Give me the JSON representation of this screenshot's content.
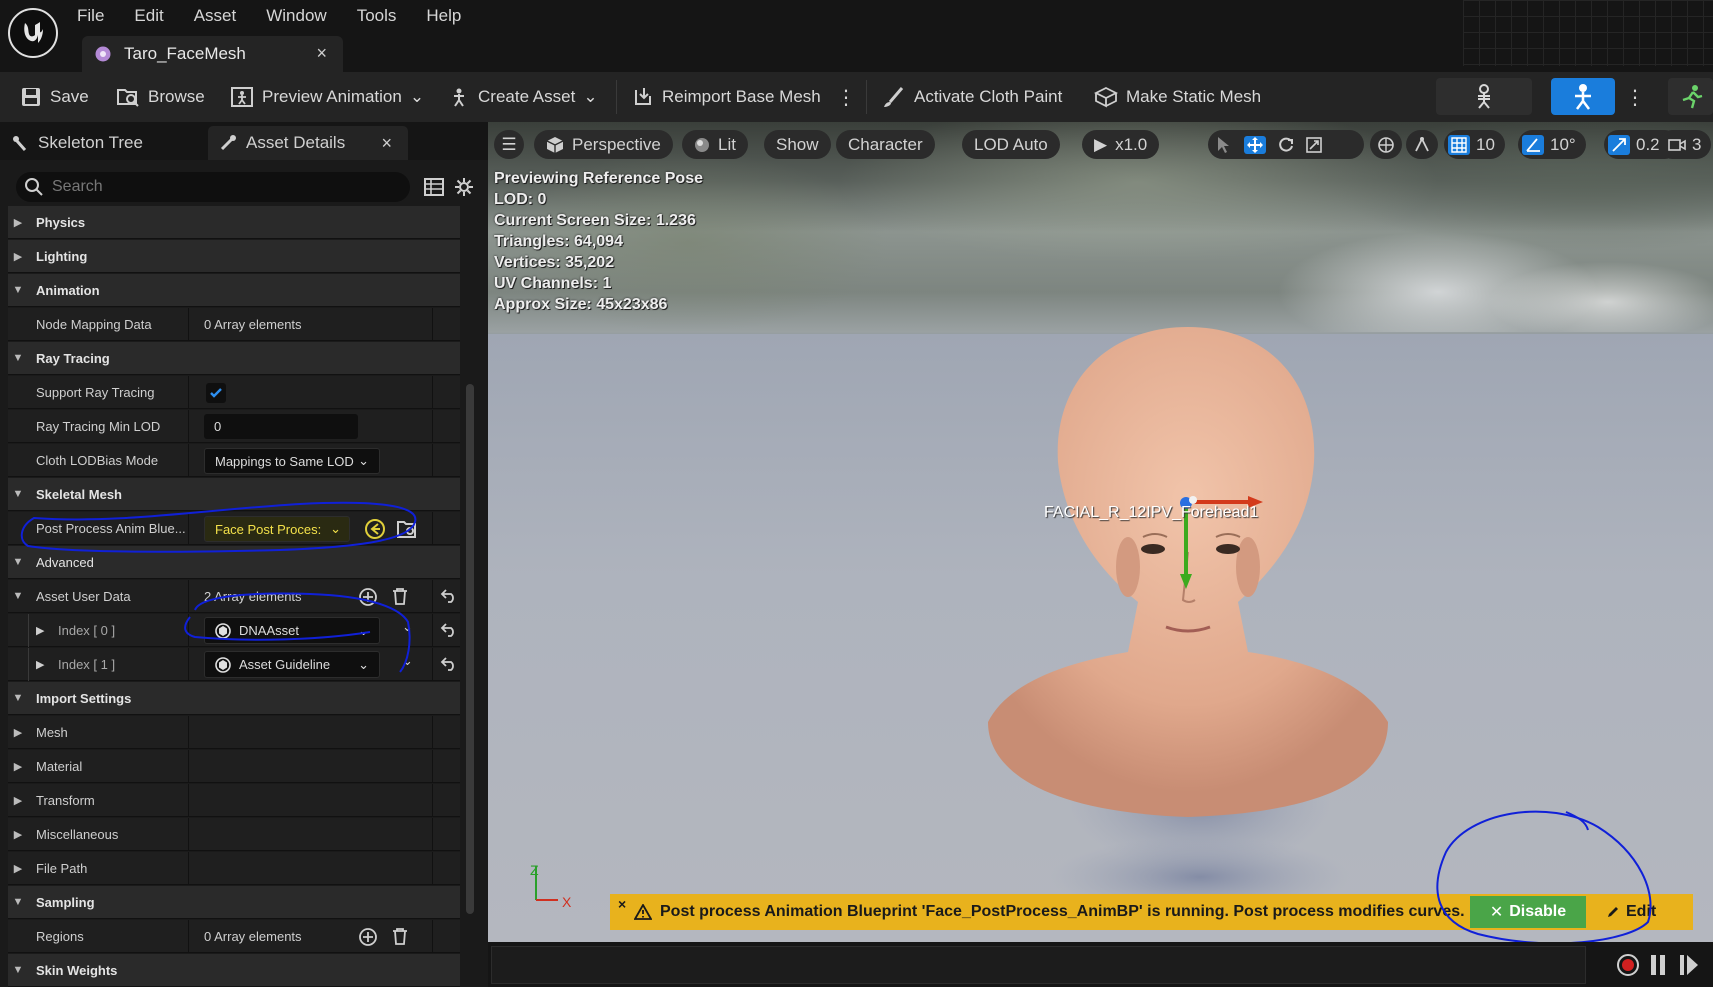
{
  "menu": [
    "File",
    "Edit",
    "Asset",
    "Window",
    "Tools",
    "Help"
  ],
  "doc_tab": {
    "title": "Taro_FaceMesh",
    "close": "×"
  },
  "toolbar": {
    "save": "Save",
    "browse": "Browse",
    "preview_animation": "Preview Animation",
    "create_asset": "Create Asset",
    "reimport": "Reimport Base Mesh",
    "cloth_paint": "Activate Cloth Paint",
    "static_mesh": "Make Static Mesh"
  },
  "panel_tabs": {
    "skeleton_tree": "Skeleton Tree",
    "asset_details": "Asset Details",
    "close": "×"
  },
  "search": {
    "placeholder": "Search"
  },
  "details": {
    "physics": "Physics",
    "lighting": "Lighting",
    "animation": "Animation",
    "node_mapping": {
      "label": "Node Mapping Data",
      "value": "0 Array elements"
    },
    "ray_tracing": "Ray Tracing",
    "support_ray_tracing": "Support Ray Tracing",
    "rt_min_lod": {
      "label": "Ray Tracing Min LOD",
      "value": "0"
    },
    "cloth_lod": {
      "label": "Cloth LODBias Mode",
      "value": "Mappings to Same LOD"
    },
    "skeletal_mesh": "Skeletal Mesh",
    "post_process": {
      "label": "Post Process Anim Blue...",
      "value": "Face Post Proces:"
    },
    "advanced": "Advanced",
    "asset_user_data": {
      "label": "Asset User Data",
      "value": "2 Array elements"
    },
    "index0": {
      "label": "Index [ 0 ]",
      "value": "DNAAsset"
    },
    "index1": {
      "label": "Index [ 1 ]",
      "value": "Asset Guideline"
    },
    "import_settings": "Import Settings",
    "mesh": "Mesh",
    "material": "Material",
    "transform": "Transform",
    "misc": "Miscellaneous",
    "file_path": "File Path",
    "sampling": "Sampling",
    "regions": {
      "label": "Regions",
      "value": "0 Array elements"
    },
    "skin_weights": "Skin Weights"
  },
  "viewport": {
    "perspective": "Perspective",
    "lit": "Lit",
    "show": "Show",
    "character": "Character",
    "lod": "LOD Auto",
    "speed": "x1.0",
    "grid": "10",
    "angle": "10°",
    "scale": "0.25",
    "camera": "3",
    "stats": [
      "Previewing Reference Pose",
      "LOD: 0",
      "Current Screen Size: 1.236",
      "Triangles: 64,094",
      "Vertices: 35,202",
      "UV Channels: 1",
      "Approx Size: 45x23x86"
    ],
    "bone_label": "FACIAL_R_12IPV_Forehead1",
    "axis_z": "Z",
    "axis_x": "X",
    "banner": "Post process Animation Blueprint 'Face_PostProcess_AnimBP' is running. Post process modifies curves.",
    "banner_close": "×",
    "disable": "Disable",
    "edit": "Edit"
  },
  "colors": {
    "accent_blue": "#1a7ddc",
    "banner_yellow": "#e8b21d",
    "disable_green": "#4aa548",
    "annotation_blue": "#1020d8"
  }
}
